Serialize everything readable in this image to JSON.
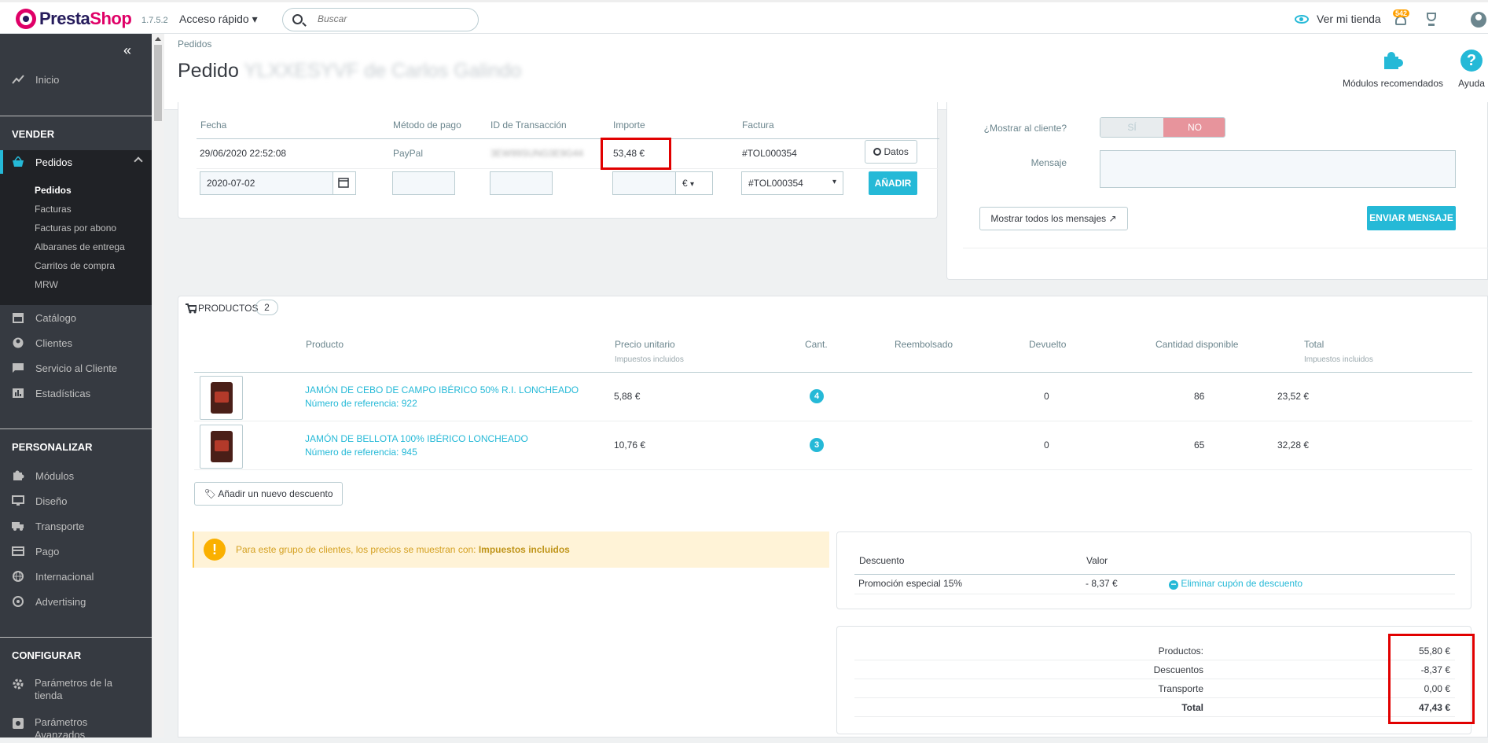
{
  "topbar": {
    "logo_pre": "Presta",
    "logo_post": "Shop",
    "version": "1.7.5.2",
    "quick_access": "Acceso rápido ▾",
    "search_placeholder": "Buscar",
    "view_store": "Ver mi tienda",
    "notif_count": "542"
  },
  "sidebar": {
    "inicio": "Inicio",
    "sec_vender": "VENDER",
    "pedidos": "Pedidos",
    "pedidos_sub": [
      "Pedidos",
      "Facturas",
      "Facturas por abono",
      "Albaranes de entrega",
      "Carritos de compra",
      "MRW"
    ],
    "catalogo": "Catálogo",
    "clientes": "Clientes",
    "servicio": "Servicio al Cliente",
    "estadisticas": "Estadísticas",
    "sec_personalizar": "PERSONALIZAR",
    "modulos": "Módulos",
    "diseno": "Diseño",
    "transporte": "Transporte",
    "pago": "Pago",
    "internacional": "Internacional",
    "advertising": "Advertising",
    "sec_configurar": "CONFIGURAR",
    "param_tienda_1": "Parámetros de la",
    "param_tienda_2": "tienda",
    "param_avanz_1": "Parámetros",
    "param_avanz_2": "Avanzados"
  },
  "header": {
    "breadcrumb": "Pedidos",
    "title_prefix": "Pedido",
    "title_blurred": "YLXXESYVF de Carlos Galindo",
    "modules_label": "Módulos recomendados",
    "help_label": "Ayuda"
  },
  "payment": {
    "col_fecha": "Fecha",
    "col_metodo": "Método de pago",
    "col_transaccion": "ID de Transacción",
    "col_importe": "Importe",
    "col_factura": "Factura",
    "row_fecha": "29/06/2020 22:52:08",
    "row_metodo": "PayPal",
    "row_transaccion": "3EW99SUNG3E9G44",
    "row_importe": "53,48 €",
    "row_factura": "#TOL000354",
    "datos_btn": "Datos",
    "new_date": "2020-07-02",
    "currency": "€",
    "invoice_select": "#TOL000354",
    "add_btn": "AÑADIR"
  },
  "messages": {
    "show_customer_label": "¿Mostrar al cliente?",
    "si": "SÍ",
    "no": "NO",
    "mensaje_label": "Mensaje",
    "show_all_btn": "Mostrar todos los mensajes",
    "send_btn": "ENVIAR MENSAJE"
  },
  "products": {
    "title": "PRODUCTOS",
    "count": "2",
    "col_producto": "Producto",
    "col_precio": "Precio unitario",
    "col_precio_sub": "Impuestos incluidos",
    "col_cant": "Cant.",
    "col_reembolsado": "Reembolsado",
    "col_devuelto": "Devuelto",
    "col_disponible": "Cantidad disponible",
    "col_total": "Total",
    "col_total_sub": "Impuestos incluidos",
    "rows": [
      {
        "name": "JAMÓN DE CEBO DE CAMPO IBÉRICO 50% R.I. LONCHEADO",
        "ref": "Número de referencia: 922",
        "price": "5,88 €",
        "qty": "4",
        "returned": "0",
        "available": "86",
        "total": "23,52 €"
      },
      {
        "name": "JAMÓN DE BELLOTA 100% IBÉRICO LONCHEADO",
        "ref": "Número de referencia: 945",
        "price": "10,76 €",
        "qty": "3",
        "returned": "0",
        "available": "65",
        "total": "32,28 €"
      }
    ],
    "add_discount_btn": "Añadir un nuevo descuento"
  },
  "alert": {
    "text": "Para este grupo de clientes, los precios se muestran con:",
    "bold": "Impuestos incluidos"
  },
  "discounts": {
    "col_descuento": "Descuento",
    "col_valor": "Valor",
    "row_name": "Promoción especial 15%",
    "row_value": "- 8,37 €",
    "remove_link": "Eliminar cupón de descuento"
  },
  "totals": {
    "productos_label": "Productos:",
    "productos_value": "55,80 €",
    "descuentos_label": "Descuentos",
    "descuentos_value": "-8,37 €",
    "transporte_label": "Transporte",
    "transporte_value": "0,00 €",
    "total_label": "Total",
    "total_value": "47,43 €"
  },
  "colors": {
    "accent": "#25b9d7",
    "sidebar": "#363a41",
    "highlight": "#e10000",
    "brand": "#df0067"
  }
}
